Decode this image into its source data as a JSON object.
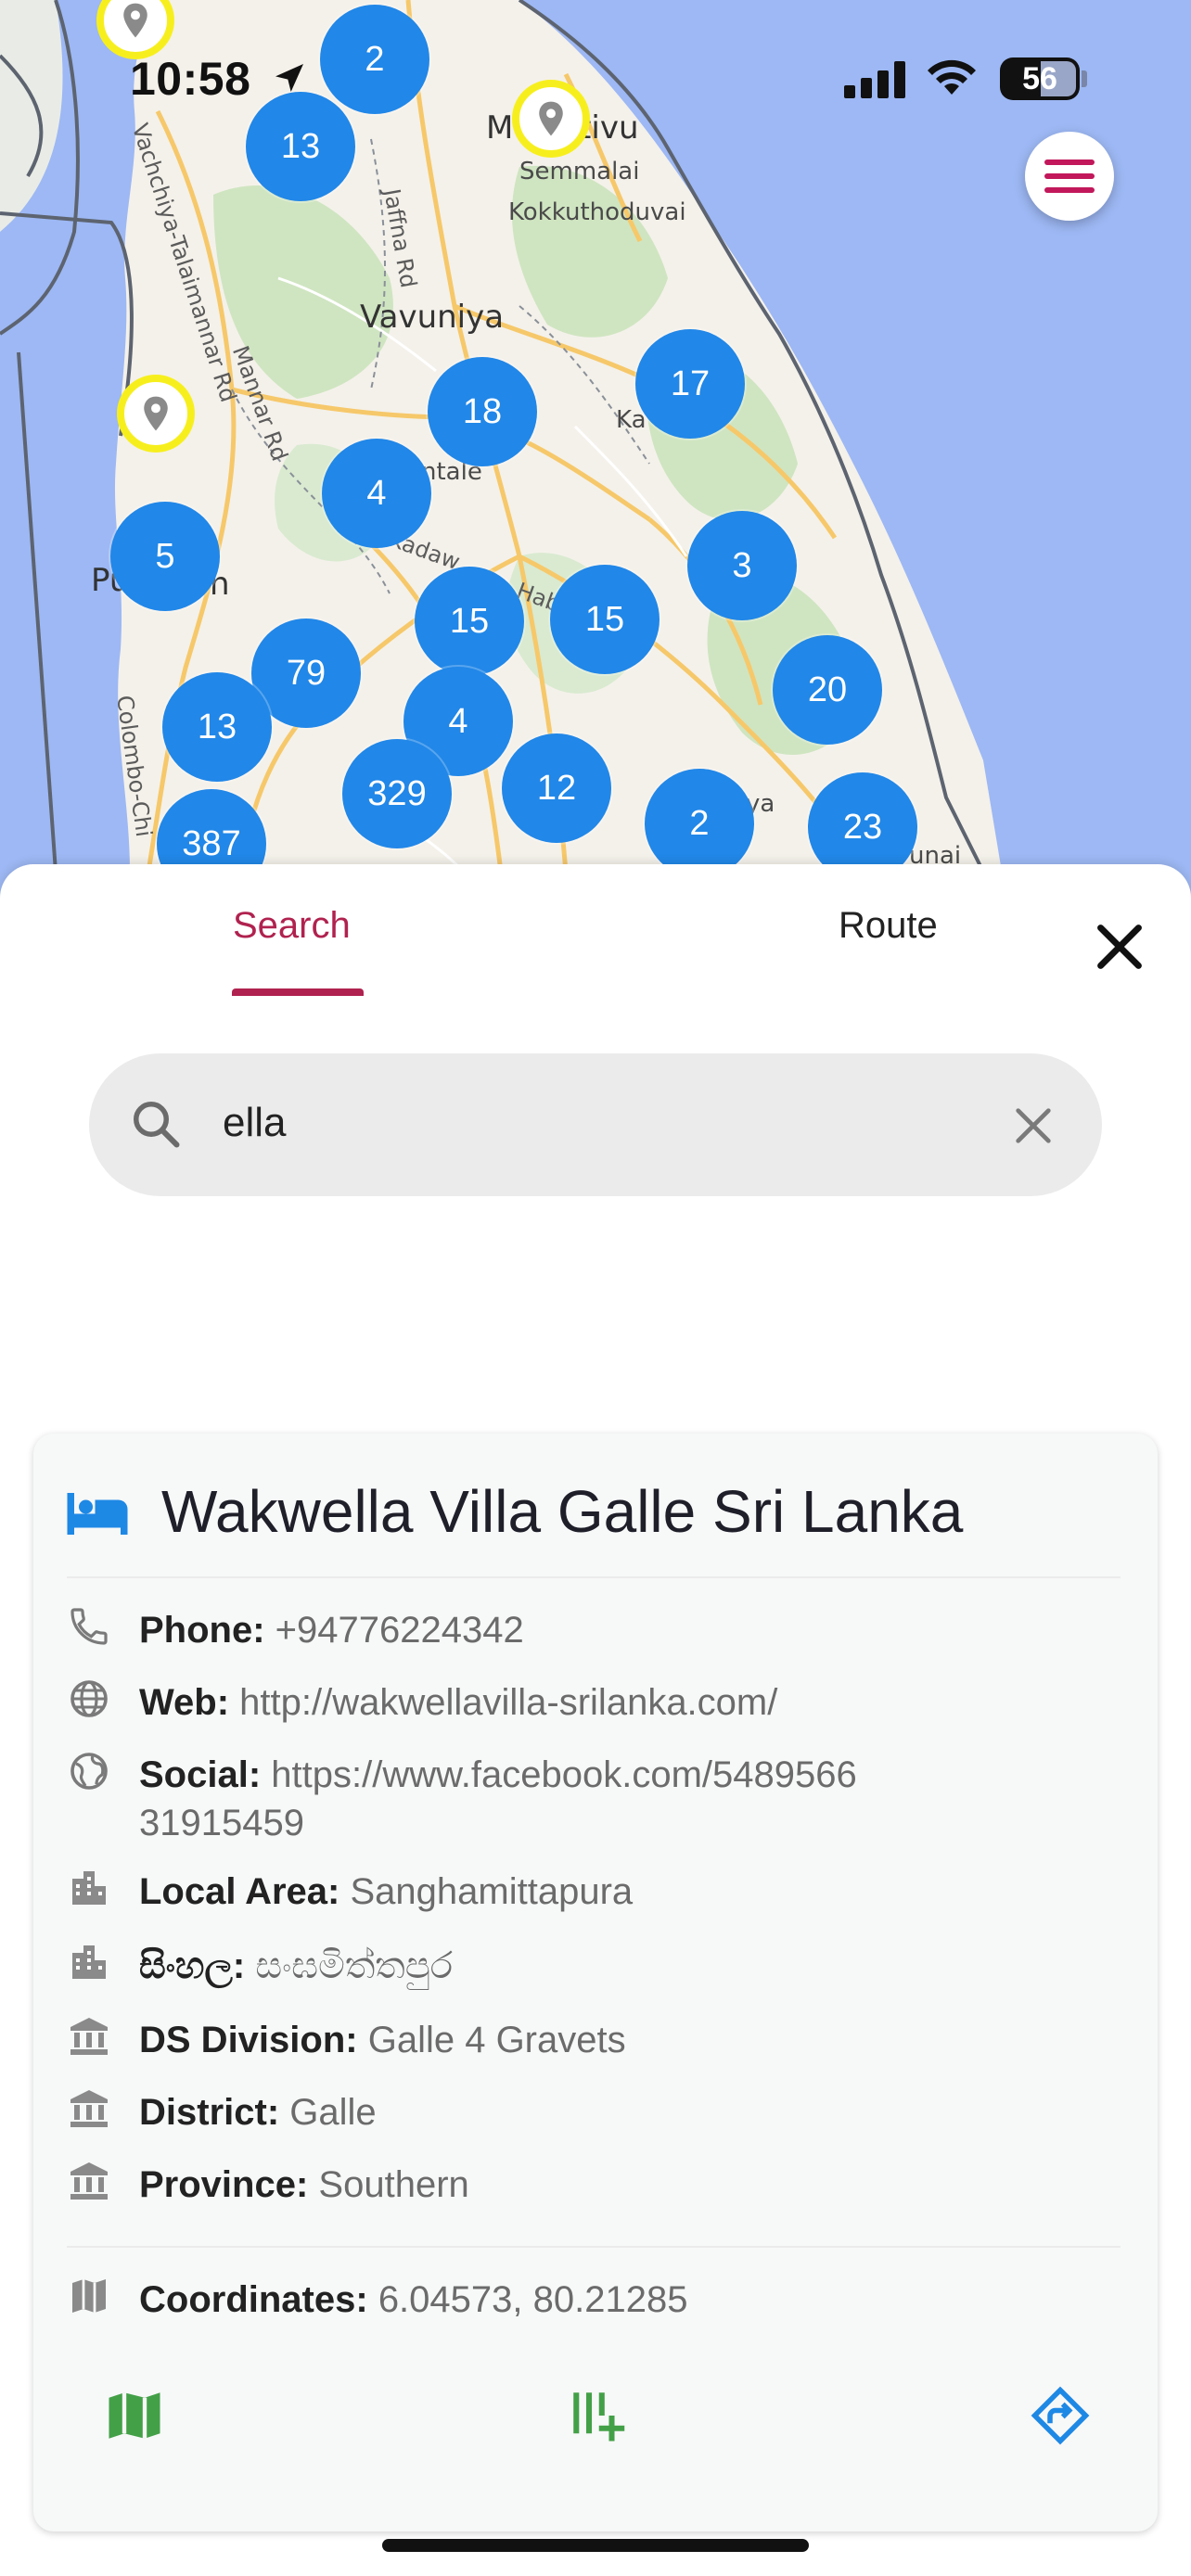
{
  "status_bar": {
    "time": "10:58"
  },
  "map": {
    "places": [
      "Vavuniya",
      "Semmalai",
      "Kokkuthoduvai",
      "Mullaitivu",
      "ntale",
      "Pu",
      "n",
      "Ka",
      "ya",
      "unai"
    ],
    "roads": [
      "Jaffna Rd",
      "Vachchiya-Talaimannar Rd",
      "Colombo-Chi",
      "Mannar Rd",
      "Kadaw",
      "Hab",
      "Ma"
    ],
    "clusters": [
      "2",
      "13",
      "17",
      "18",
      "4",
      "5",
      "3",
      "15",
      "15",
      "79",
      "20",
      "13",
      "4",
      "12",
      "329",
      "2",
      "23",
      "387"
    ],
    "pin_icon": "location-pin-icon"
  },
  "menu_button_icon": "hamburger-menu-icon",
  "tabs": [
    {
      "label": "Search",
      "active": true
    },
    {
      "label": "Route",
      "active": false
    }
  ],
  "search": {
    "value": "ella"
  },
  "result": {
    "title": "Wakwella Villa Galle Sri Lanka",
    "title_icon": "hotel-bed-icon",
    "rows": [
      {
        "icon": "phone-icon",
        "label": "Phone:",
        "value": "+94776224342"
      },
      {
        "icon": "globe-icon",
        "label": "Web:",
        "value": "http://wakwellavilla-srilanka.com/"
      },
      {
        "icon": "public-globe-icon",
        "label": "Social:",
        "value": "https://www.facebook.com/548956631915459"
      },
      {
        "icon": "buildings-icon",
        "label": "Local Area:",
        "value": "Sanghamittapura"
      },
      {
        "icon": "buildings-icon",
        "label": "සිංහල:",
        "value": "සංඝමිත්තපුර"
      },
      {
        "icon": "institution-icon",
        "label": "DS Division:",
        "value": "Galle 4 Gravets"
      },
      {
        "icon": "institution-icon",
        "label": "District:",
        "value": "Galle"
      },
      {
        "icon": "institution-icon",
        "label": "Province:",
        "value": "Southern"
      }
    ],
    "coordinates": {
      "icon": "map-icon",
      "label": "Coordinates:",
      "value": "6.04573, 80.21285"
    },
    "actions": [
      {
        "icon": "open-map-icon",
        "color": "#43a047"
      },
      {
        "icon": "add-to-list-icon",
        "color": "#43a047"
      },
      {
        "icon": "directions-icon",
        "color": "#1e88e5"
      }
    ]
  },
  "colors": {
    "accent": "#b0224f",
    "cluster": "#2187e8",
    "pin_ring": "#f7ef1d",
    "water": "#9db8f4",
    "land": "#f4f1ea"
  }
}
